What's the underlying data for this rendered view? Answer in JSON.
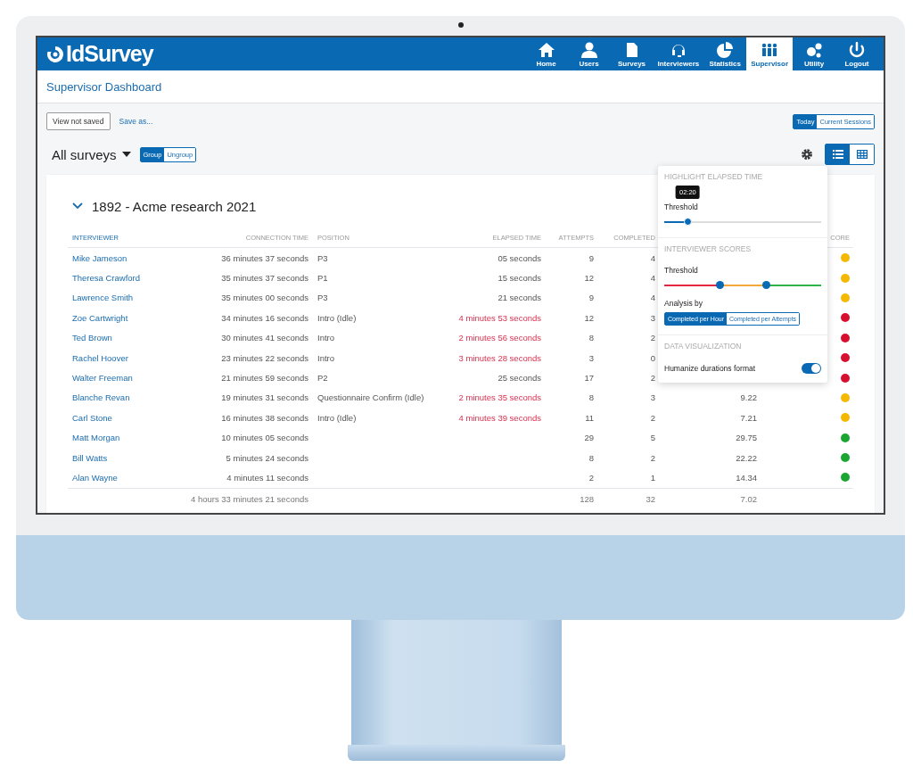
{
  "app": {
    "logo": "IdSurvey"
  },
  "nav": [
    {
      "label": "Home",
      "selected": false
    },
    {
      "label": "Users",
      "selected": false
    },
    {
      "label": "Surveys",
      "selected": false
    },
    {
      "label": "Interviewers",
      "selected": false
    },
    {
      "label": "Statistics",
      "selected": false
    },
    {
      "label": "Supervisor",
      "selected": true
    },
    {
      "label": "Utility",
      "selected": false
    },
    {
      "label": "Logout",
      "selected": false
    }
  ],
  "page_title": "Supervisor Dashboard",
  "toolbar": {
    "view_button": "View not saved",
    "save_link": "Save as...",
    "range_tabs": [
      {
        "label": "Today",
        "selected": true
      },
      {
        "label": "Current Sessions",
        "selected": false
      }
    ]
  },
  "survey_select": "All surveys",
  "group_tabs": [
    {
      "label": "Group",
      "selected": true
    },
    {
      "label": "Ungroup",
      "selected": false
    }
  ],
  "view_modes": [
    {
      "selected": true
    },
    {
      "selected": false
    }
  ],
  "survey_title": "1892 - Acme research 2021",
  "table": {
    "columns": [
      "INTERVIEWER",
      "CONNECTION TIME",
      "POSITION",
      "ELAPSED TIME",
      "ATTEMPTS",
      "COMPLETED",
      "",
      "CORE"
    ],
    "rows": [
      {
        "name": "Mike Jameson",
        "connection": "36 minutes 37 seconds",
        "position": "P3",
        "elapsed": "05 seconds",
        "highlighted": false,
        "attempts": "9",
        "completed": "4",
        "color": "#f5b800"
      },
      {
        "name": "Theresa Crawford",
        "connection": "35 minutes 37 seconds",
        "position": "P1",
        "elapsed": "15 seconds",
        "highlighted": false,
        "attempts": "12",
        "completed": "4",
        "color": "#f5b800"
      },
      {
        "name": "Lawrence Smith",
        "connection": "35 minutes 00 seconds",
        "position": "P3",
        "elapsed": "21 seconds",
        "highlighted": false,
        "attempts": "9",
        "completed": "4",
        "color": "#f5b800"
      },
      {
        "name": "Zoe Cartwright",
        "connection": "34 minutes 16 seconds",
        "position": "Intro (Idle)",
        "elapsed": "4 minutes 53 seconds",
        "highlighted": true,
        "attempts": "12",
        "completed": "3",
        "color": "#d8102f"
      },
      {
        "name": "Ted Brown",
        "connection": "30 minutes 41 seconds",
        "position": "Intro",
        "elapsed": "2 minutes 56 seconds",
        "highlighted": true,
        "attempts": "8",
        "completed": "2",
        "color": "#d8102f"
      },
      {
        "name": "Rachel Hoover",
        "connection": "23 minutes 22 seconds",
        "position": "Intro",
        "elapsed": "3 minutes 28 seconds",
        "highlighted": true,
        "attempts": "3",
        "completed": "0",
        "color": "#d8102f"
      },
      {
        "name": "Walter Freeman",
        "connection": "21 minutes 59 seconds",
        "position": "P2",
        "elapsed": "25 seconds",
        "highlighted": false,
        "attempts": "17",
        "completed": "2",
        "color": "#d8102f"
      },
      {
        "name": "Blanche Revan",
        "connection": "19 minutes 31 seconds",
        "position": "Questionnaire Confirm (Idle)",
        "elapsed": "2 minutes 35 seconds",
        "highlighted": true,
        "attempts": "8",
        "completed": "3",
        "column_7": "9.22",
        "color": "#f5b800"
      },
      {
        "name": "Carl Stone",
        "connection": "16 minutes 38 seconds",
        "position": "Intro (Idle)",
        "elapsed": "4 minutes 39 seconds",
        "highlighted": true,
        "attempts": "11",
        "completed": "2",
        "column_7": "7.21",
        "color": "#f5b800"
      },
      {
        "name": "Matt Morgan",
        "connection": "10 minutes 05 seconds",
        "attempts": "29",
        "completed": "5",
        "column_7": "29.75",
        "color": "#1aa631"
      },
      {
        "name": "Bill Watts",
        "connection": "5 minutes 24 seconds",
        "attempts": "8",
        "completed": "2",
        "column_7": "22.22",
        "color": "#1aa631"
      },
      {
        "name": "Alan Wayne",
        "connection": "4 minutes 11 seconds",
        "attempts": "2",
        "completed": "1",
        "column_7": "14.34",
        "color": "#1aa631"
      }
    ],
    "totals": {
      "connection": "4 hours 33 minutes 21 seconds",
      "attempts": "128",
      "completed": "32",
      "column_7": "7.02"
    }
  },
  "settings": {
    "elapsed_heading": "HIGHLIGHT ELAPSED TIME",
    "elapsed_label": "Threshold",
    "elapsed_slider": {
      "level": 0.15,
      "tooltip": "02:20"
    },
    "scores_heading": "INTERVIEWER SCORES",
    "scores_label": "Threshold",
    "score_thumbs": [
      {
        "level": 0.35
      },
      {
        "level": 0.65
      }
    ],
    "analysis_label": "Analysis by",
    "analysis_tabs": [
      {
        "label": "Completed per Hour",
        "selected": true
      },
      {
        "label": "Completed per Attempts",
        "selected": false
      }
    ],
    "viz_heading": "DATA VISUALIZATION",
    "humanize": {
      "label": "Humanize durations format",
      "on": true
    }
  }
}
